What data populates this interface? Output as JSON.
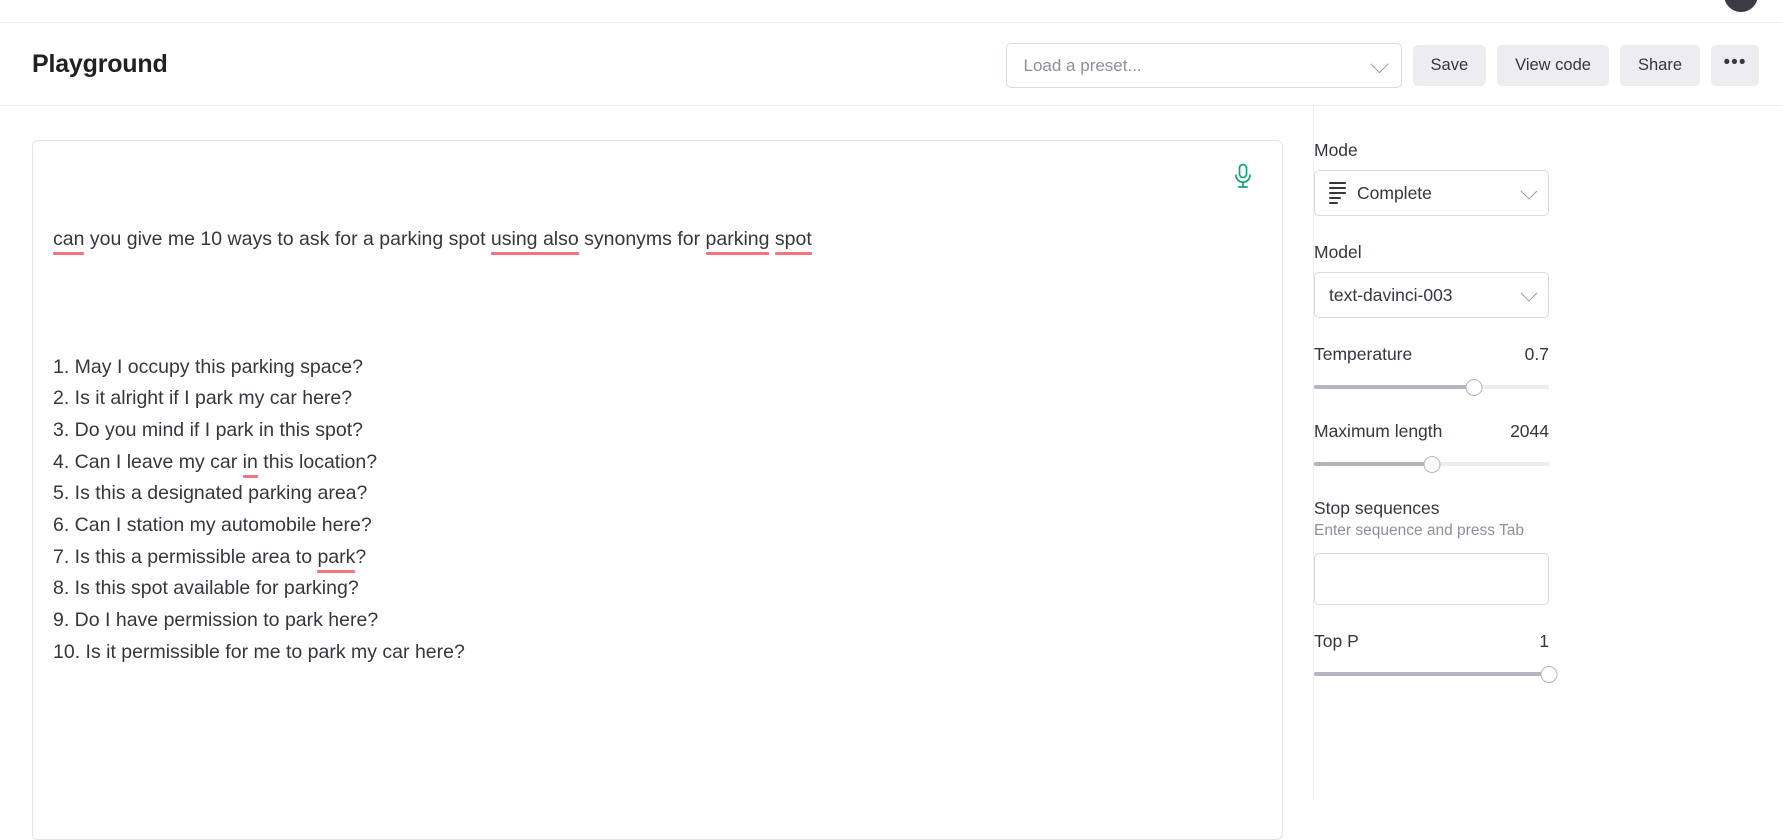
{
  "header": {
    "title": "Playground",
    "preset_placeholder": "Load a preset...",
    "preset_value": "",
    "buttons": {
      "save": "Save",
      "view_code": "View code",
      "share": "Share",
      "more": "•••"
    }
  },
  "editor": {
    "prompt": "can you give me 10 ways to ask for a parking spot using also synonyms for parking spot",
    "prompt_segments": [
      {
        "text": "can",
        "misspelled": true
      },
      {
        "text": " you give me 10 ways to ask for a parking spot ",
        "misspelled": false
      },
      {
        "text": "using also",
        "misspelled": true
      },
      {
        "text": " synonyms for ",
        "misspelled": false
      },
      {
        "text": "parking",
        "misspelled": true
      },
      {
        "text": " ",
        "misspelled": false
      },
      {
        "text": "spot",
        "misspelled": true
      }
    ],
    "completion_items": [
      {
        "number": "1.",
        "segments": [
          {
            "text": " May I occupy this parking space?",
            "misspelled": false
          }
        ]
      },
      {
        "number": "2.",
        "segments": [
          {
            "text": " Is it alright if I park my car here?",
            "misspelled": false
          }
        ]
      },
      {
        "number": "3.",
        "segments": [
          {
            "text": " Do you mind if I park in this spot?",
            "misspelled": false
          }
        ]
      },
      {
        "number": "4.",
        "segments": [
          {
            "text": " Can I leave my car ",
            "misspelled": false
          },
          {
            "text": "in",
            "misspelled": true
          },
          {
            "text": " this location?",
            "misspelled": false
          }
        ]
      },
      {
        "number": "5.",
        "segments": [
          {
            "text": " Is this a designated parking area?",
            "misspelled": false
          }
        ]
      },
      {
        "number": "6.",
        "segments": [
          {
            "text": " Can I station my automobile here?",
            "misspelled": false
          }
        ]
      },
      {
        "number": "7.",
        "segments": [
          {
            "text": " Is this a permissible area to ",
            "misspelled": false
          },
          {
            "text": "park",
            "misspelled": true
          },
          {
            "text": "?",
            "misspelled": false
          }
        ]
      },
      {
        "number": "8.",
        "segments": [
          {
            "text": " Is this spot available for parking?",
            "misspelled": false
          }
        ]
      },
      {
        "number": "9.",
        "segments": [
          {
            "text": " Do I have permission to park here?",
            "misspelled": false
          }
        ]
      },
      {
        "number": "10.",
        "segments": [
          {
            "text": " Is it permissible for me to park my car here?",
            "misspelled": false
          }
        ]
      }
    ],
    "mic_icon": "microphone-icon"
  },
  "sidebar": {
    "mode": {
      "label": "Mode",
      "value": "Complete",
      "icon": "list-lines-icon"
    },
    "model": {
      "label": "Model",
      "value": "text-davinci-003"
    },
    "temperature": {
      "label": "Temperature",
      "value": "0.7",
      "percent": 68
    },
    "maximum_length": {
      "label": "Maximum length",
      "value": "2044",
      "percent": 50
    },
    "stop_sequences": {
      "label": "Stop sequences",
      "hint": "Enter sequence and press Tab",
      "value": "",
      "placeholder": ""
    },
    "top_p": {
      "label": "Top P",
      "value": "1",
      "percent": 100
    }
  },
  "colors": {
    "accent_green": "#10a37f",
    "spellcheck_red": "#f4737e",
    "button_bg": "#ececf1",
    "text": "#353740",
    "muted": "#8e8ea0",
    "border": "#d9d9e3"
  }
}
